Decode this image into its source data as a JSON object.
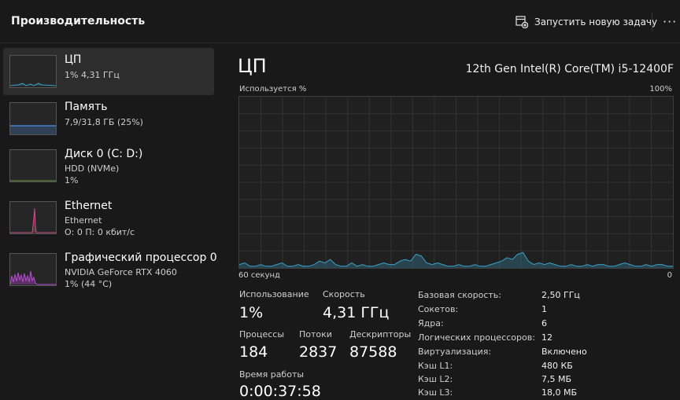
{
  "header": {
    "title": "Производительность",
    "run_task_label": "Запустить новую задачу",
    "more_label": "···"
  },
  "sidebar": {
    "items": [
      {
        "name": "ЦП",
        "sub1": "1% 4,31 ГГц",
        "sub2": "",
        "color": "#3aa3c8"
      },
      {
        "name": "Память",
        "sub1": "7,9/31,8 ГБ (25%)",
        "sub2": "",
        "color": "#4f8fe8"
      },
      {
        "name": "Диск 0 (C: D:)",
        "sub1": "HDD (NVMe)",
        "sub2": "1%",
        "color": "#7fc84a"
      },
      {
        "name": "Ethernet",
        "sub1": "Ethernet",
        "sub2": "О: 0 П: 0 кбит/с",
        "color": "#d24c86"
      },
      {
        "name": "Графический процессор 0",
        "sub1": "NVIDIA GeForce RTX 4060",
        "sub2": "1% (44 °C)",
        "color": "#b94ad8"
      }
    ]
  },
  "main": {
    "title": "ЦП",
    "model": "12th Gen Intel(R) Core(TM) i5-12400F",
    "graph": {
      "label_top_left": "Используется %",
      "label_top_right": "100%",
      "label_bottom_left": "60 секунд",
      "label_bottom_right": "0",
      "line_color": "#3aa3c8",
      "usage_percent_series": [
        2,
        3,
        1,
        1,
        2,
        1,
        1,
        2,
        3,
        1,
        1,
        2,
        1,
        1,
        2,
        4,
        3,
        5,
        2,
        1,
        1,
        3,
        1,
        2,
        1,
        1,
        2,
        3,
        2,
        2,
        4,
        5,
        4,
        8,
        7,
        3,
        2,
        3,
        2,
        1,
        1,
        2,
        1,
        1,
        2,
        1,
        1,
        2,
        3,
        4,
        6,
        5,
        8,
        9,
        4,
        2,
        3,
        2,
        3,
        2,
        1,
        1,
        2,
        1,
        1,
        2,
        1,
        2,
        2,
        1,
        1,
        2,
        3,
        2,
        1,
        1,
        2,
        1,
        2,
        2,
        1,
        1
      ]
    },
    "stats": {
      "usage_label": "Использование",
      "usage_value": "1%",
      "speed_label": "Скорость",
      "speed_value": "4,31 ГГц",
      "processes_label": "Процессы",
      "processes_value": "184",
      "threads_label": "Потоки",
      "threads_value": "2837",
      "handles_label": "Дескрипторы",
      "handles_value": "87588",
      "uptime_label": "Время работы",
      "uptime_value": "0:00:37:58"
    },
    "specs": [
      {
        "k": "Базовая скорость:",
        "v": "2,50 ГГц"
      },
      {
        "k": "Сокетов:",
        "v": "1"
      },
      {
        "k": "Ядра:",
        "v": "6"
      },
      {
        "k": "Логических процессоров:",
        "v": "12"
      },
      {
        "k": "Виртуализация:",
        "v": "Включено"
      },
      {
        "k": "Кэш L1:",
        "v": "480 КБ"
      },
      {
        "k": "Кэш L2:",
        "v": "7,5 МБ"
      },
      {
        "k": "Кэш L3:",
        "v": "18,0 МБ"
      }
    ]
  }
}
